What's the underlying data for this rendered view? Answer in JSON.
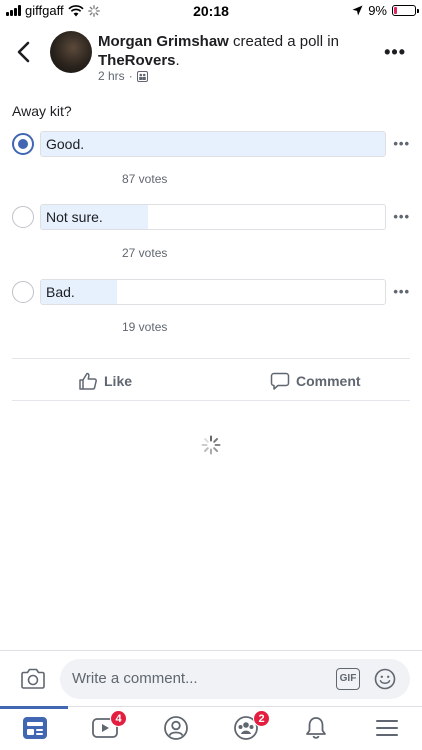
{
  "status_bar": {
    "carrier": "giffgaff",
    "time": "20:18",
    "battery": "9%"
  },
  "post": {
    "author": "Morgan Grimshaw",
    "action_text": " created a poll in ",
    "group": "TheRovers",
    "group_suffix": ".",
    "time": "2 hrs",
    "meta_separator": "·"
  },
  "poll": {
    "question": "Away kit?",
    "options": [
      {
        "label": "Good.",
        "votes_text": "87 votes",
        "votes": 87,
        "selected": true
      },
      {
        "label": "Not sure.",
        "votes_text": "27 votes",
        "votes": 27,
        "selected": false
      },
      {
        "label": "Bad.",
        "votes_text": "19 votes",
        "votes": 19,
        "selected": false
      }
    ]
  },
  "actions": {
    "like": "Like",
    "comment": "Comment"
  },
  "comment_bar": {
    "placeholder": "Write a comment...",
    "gif": "GIF"
  },
  "tab_bar": {
    "video_badge": "4",
    "groups_badge": "2"
  },
  "colors": {
    "accent": "#4267b2",
    "poll_fill": "#e7f0fd",
    "badge": "#e41e3f",
    "secondary_text": "#606770"
  }
}
